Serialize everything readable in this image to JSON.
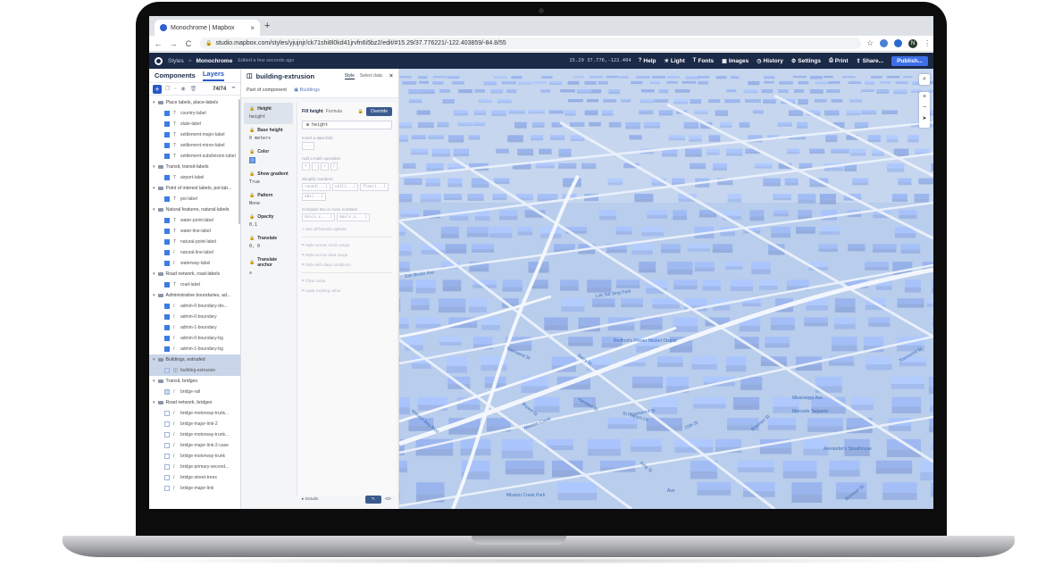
{
  "browser": {
    "tab_title": "Monochrome | Mapbox",
    "new_tab": "+",
    "tab_close": "×",
    "back": "←",
    "forward": "→",
    "reload": "C",
    "url": "studio.mapbox.com/styles/yjujnjr/ck71shi8l0kd41jrvfn6i5bz2/edit/#15.29/37.776221/-122.403859/-84.8/55",
    "profile_initial": "N",
    "star": "☆",
    "more": "⋮"
  },
  "studio": {
    "breadcrumb": "Styles",
    "separator": ">",
    "style_name": "Monochrome",
    "edited": "Edited a few seconds ago",
    "coords": "15.29  37.776,-122.404",
    "toolbar": [
      {
        "icon": "?",
        "label": "Help"
      },
      {
        "icon": "☀",
        "label": "Light"
      },
      {
        "icon": "T",
        "label": "Fonts"
      },
      {
        "icon": "▣",
        "label": "Images"
      },
      {
        "icon": "◷",
        "label": "History"
      },
      {
        "icon": "⚙",
        "label": "Settings"
      },
      {
        "icon": "⎙",
        "label": "Print"
      },
      {
        "icon": "⇪",
        "label": "Share..."
      }
    ],
    "publish": "Publish..."
  },
  "left_panel": {
    "tab_components": "Components",
    "tab_layers": "Layers",
    "add": "+",
    "layer_count": "74/74",
    "groups": [
      {
        "name": "Place labels, place-labels",
        "layers": [
          {
            "type": "T",
            "name": "country-label",
            "swatch": "filled"
          },
          {
            "type": "T",
            "name": "state-label",
            "swatch": "filled"
          },
          {
            "type": "T",
            "name": "settlement-major-label",
            "swatch": "filled"
          },
          {
            "type": "T",
            "name": "settlement-minor-label",
            "swatch": "filled"
          },
          {
            "type": "T",
            "name": "settlement-subdivision-label",
            "swatch": "filled"
          }
        ]
      },
      {
        "name": "Transit, transit-labels",
        "layers": [
          {
            "type": "T",
            "name": "airport-label",
            "swatch": "filled"
          }
        ]
      },
      {
        "name": "Point of interest labels, poi-lab...",
        "layers": [
          {
            "type": "T",
            "name": "poi-label",
            "swatch": "filled"
          }
        ]
      },
      {
        "name": "Natural features, natural-labels",
        "layers": [
          {
            "type": "T",
            "name": "water-point-label",
            "swatch": "filled"
          },
          {
            "type": "T",
            "name": "water-line-label",
            "swatch": "filled"
          },
          {
            "type": "T",
            "name": "natural-point-label",
            "swatch": "filled"
          },
          {
            "type": "/",
            "name": "natural-line-label",
            "swatch": "filled"
          },
          {
            "type": "/",
            "name": "waterway-label",
            "swatch": "filled"
          }
        ]
      },
      {
        "name": "Road network, road-labels",
        "layers": [
          {
            "type": "T",
            "name": "road-label",
            "swatch": "filled"
          }
        ]
      },
      {
        "name": "Administrative boundaries, ad...",
        "layers": [
          {
            "type": "/",
            "name": "admin-0-boundary-dis...",
            "swatch": "filled"
          },
          {
            "type": "/",
            "name": "admin-0-boundary",
            "swatch": "filled"
          },
          {
            "type": "/",
            "name": "admin-1-boundary",
            "swatch": "filled"
          },
          {
            "type": "/",
            "name": "admin-0-boundary-bg",
            "swatch": "filled"
          },
          {
            "type": "/",
            "name": "admin-1-boundary-bg",
            "swatch": "filled"
          }
        ]
      },
      {
        "name": "Buildings, extruded",
        "selected": true,
        "layers": [
          {
            "type": "◫",
            "name": "building-extrusion",
            "swatch": "pale",
            "selected": true
          }
        ]
      },
      {
        "name": "Transit, bridges",
        "layers": [
          {
            "type": "/",
            "name": "bridge-rail",
            "swatch": "pale"
          }
        ]
      },
      {
        "name": "Road network, bridges",
        "layers": [
          {
            "type": "/",
            "name": "bridge-motorway-trunk...",
            "swatch": "empty"
          },
          {
            "type": "/",
            "name": "bridge-major-link-2",
            "swatch": "empty"
          },
          {
            "type": "/",
            "name": "bridge-motorway-trunk...",
            "swatch": "empty"
          },
          {
            "type": "/",
            "name": "bridge-major-link-2-case",
            "swatch": "empty"
          },
          {
            "type": "/",
            "name": "bridge-motorway-trunk",
            "swatch": "empty"
          },
          {
            "type": "/",
            "name": "bridge-primary-second...",
            "swatch": "empty"
          },
          {
            "type": "/",
            "name": "bridge-street-trees",
            "swatch": "empty"
          },
          {
            "type": "/",
            "name": "bridge-major-link",
            "swatch": "empty"
          }
        ]
      }
    ]
  },
  "props": {
    "layer_name": "building-extrusion",
    "tab_style": "Style",
    "tab_select_data": "Select data",
    "close": "×",
    "part_of": "Part of component",
    "component": "Buildings",
    "properties": [
      {
        "label": "Height",
        "value": "height",
        "kind": "text",
        "active": true
      },
      {
        "label": "Base height",
        "value": "0 meters",
        "kind": "text"
      },
      {
        "label": "Color",
        "value": "",
        "kind": "swatch",
        "color": "#7aa5e8"
      },
      {
        "label": "Show gradient",
        "value": "True",
        "kind": "text"
      },
      {
        "label": "Pattern",
        "value": "None",
        "kind": "text"
      },
      {
        "label": "Opacity",
        "value": "0.1",
        "kind": "text"
      },
      {
        "label": "Translate",
        "value": "0, 0",
        "kind": "text"
      },
      {
        "label": "Translate anchor",
        "value": "",
        "kind": "icon"
      }
    ],
    "editor": {
      "field_label": "Fill height",
      "mode": "Formula",
      "override": "Override",
      "expression": "height",
      "insert_hint": "Insert a data field",
      "insert_chip": "...",
      "math_hint": "Add a math operation",
      "math_chips": [
        "+",
        "-",
        "×",
        "/"
      ],
      "simplify_hint": "Simplify numbers",
      "simplify_chips": [
        "round(...)",
        "ceil(...)",
        "floor(...)",
        "abs(...)"
      ],
      "compare_hint": "Compare two or more numbers",
      "compare_chips": [
        "min(x,x,...)",
        "max(x,x,...)"
      ],
      "see_all": "See all formula options",
      "options_a": [
        "Style across zoom range",
        "Style across data range",
        "Style with data conditions"
      ],
      "options_b": [
        "Clear value",
        "Apply existing value"
      ]
    },
    "footer_details": "Details",
    "footer_b1": "↖",
    "footer_b2": "</>"
  },
  "map": {
    "search": "⌕",
    "zoom_in": "+",
    "zoom_out": "−",
    "compass": "➤",
    "labels": [
      {
        "text": "San Bruno Ave"
      },
      {
        "text": "Lok Sui Sing Park"
      },
      {
        "text": "Townsend St"
      },
      {
        "text": "Berry St"
      },
      {
        "text": "Bedford's Flower Market District"
      },
      {
        "text": "Mission Bay Blvd"
      },
      {
        "text": "Townsend St"
      },
      {
        "text": "Mississippi Ave"
      },
      {
        "text": "Brannan St"
      },
      {
        "text": "Harrison St"
      },
      {
        "text": "Bryant St"
      },
      {
        "text": "King St"
      },
      {
        "text": "Mission Creek Park"
      },
      {
        "text": "Alexander's Steakhouse"
      },
      {
        "text": "Brannan St"
      },
      {
        "text": "Mercado Taqueria"
      },
      {
        "text": "15th St"
      },
      {
        "text": "Townsend St"
      },
      {
        "text": "Mission Creek"
      },
      {
        "text": "St Francis Ln"
      },
      {
        "text": "Ave"
      }
    ]
  }
}
